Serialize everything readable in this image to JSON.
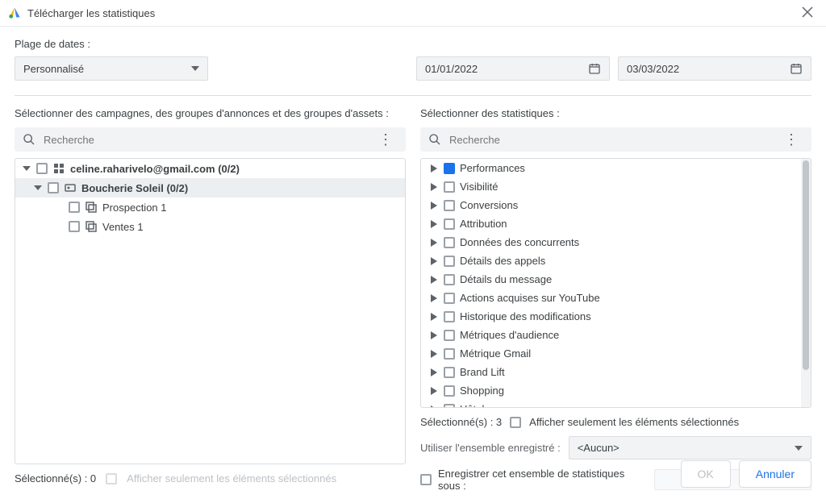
{
  "titlebar": {
    "title": "Télécharger les statistiques"
  },
  "date": {
    "label": "Plage de dates :",
    "preset": "Personnalisé",
    "from": "01/01/2022",
    "to": "03/03/2022"
  },
  "left": {
    "section_label": "Sélectionner des campagnes, des groupes d'annonces et des groupes d'assets :",
    "search_placeholder": "Recherche",
    "tree": {
      "account": "celine.raharivelo@gmail.com (0/2)",
      "campaign": "Boucherie Soleil (0/2)",
      "adgroups": [
        "Prospection 1",
        "Ventes 1"
      ]
    },
    "selected_label": "Sélectionné(s) : 0",
    "show_selected_only": "Afficher seulement les éléments sélectionnés"
  },
  "right": {
    "section_label": "Sélectionner des statistiques :",
    "search_placeholder": "Recherche",
    "categories": [
      "Performances",
      "Visibilité",
      "Conversions",
      "Attribution",
      "Données des concurrents",
      "Détails des appels",
      "Détails du message",
      "Actions acquises sur YouTube",
      "Historique des modifications",
      "Métriques d'audience",
      "Métrique Gmail",
      "Brand Lift",
      "Shopping",
      "Hôtel"
    ],
    "selected_label": "Sélectionné(s) : 3",
    "show_selected_only": "Afficher seulement les éléments sélectionnés",
    "use_saved_label": "Utiliser l'ensemble enregistré :",
    "use_saved_value": "<Aucun>",
    "save_as_label": "Enregistrer cet ensemble de statistiques sous :"
  },
  "footer": {
    "ok": "OK",
    "cancel": "Annuler"
  }
}
